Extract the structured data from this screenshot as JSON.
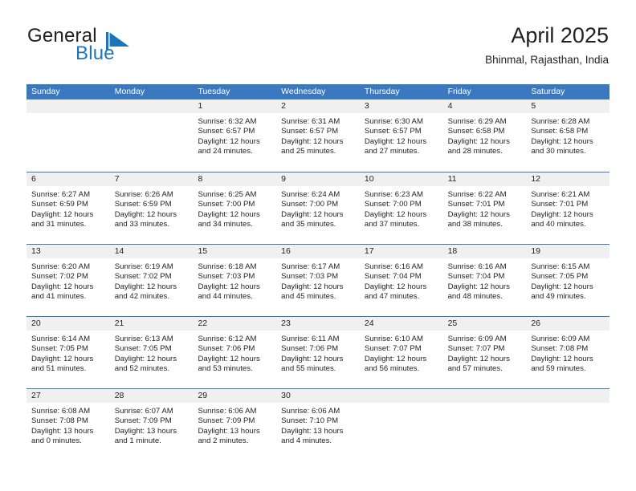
{
  "brand": {
    "word_one": "General",
    "word_two": "Blue",
    "mark": "triangle-flag-icon",
    "accent_color": "#1b75bb"
  },
  "header": {
    "title": "April 2025",
    "subtitle": "Bhinmal, Rajasthan, India"
  },
  "calendar": {
    "header_bg": "#3a78bf",
    "daynum_bg": "#f0f0f0",
    "weekday_headers": [
      "Sunday",
      "Monday",
      "Tuesday",
      "Wednesday",
      "Thursday",
      "Friday",
      "Saturday"
    ],
    "weeks": [
      [
        {
          "day": "",
          "lines": []
        },
        {
          "day": "",
          "lines": []
        },
        {
          "day": "1",
          "lines": [
            "Sunrise: 6:32 AM",
            "Sunset: 6:57 PM",
            "Daylight: 12 hours",
            "and 24 minutes."
          ]
        },
        {
          "day": "2",
          "lines": [
            "Sunrise: 6:31 AM",
            "Sunset: 6:57 PM",
            "Daylight: 12 hours",
            "and 25 minutes."
          ]
        },
        {
          "day": "3",
          "lines": [
            "Sunrise: 6:30 AM",
            "Sunset: 6:57 PM",
            "Daylight: 12 hours",
            "and 27 minutes."
          ]
        },
        {
          "day": "4",
          "lines": [
            "Sunrise: 6:29 AM",
            "Sunset: 6:58 PM",
            "Daylight: 12 hours",
            "and 28 minutes."
          ]
        },
        {
          "day": "5",
          "lines": [
            "Sunrise: 6:28 AM",
            "Sunset: 6:58 PM",
            "Daylight: 12 hours",
            "and 30 minutes."
          ]
        }
      ],
      [
        {
          "day": "6",
          "lines": [
            "Sunrise: 6:27 AM",
            "Sunset: 6:59 PM",
            "Daylight: 12 hours",
            "and 31 minutes."
          ]
        },
        {
          "day": "7",
          "lines": [
            "Sunrise: 6:26 AM",
            "Sunset: 6:59 PM",
            "Daylight: 12 hours",
            "and 33 minutes."
          ]
        },
        {
          "day": "8",
          "lines": [
            "Sunrise: 6:25 AM",
            "Sunset: 7:00 PM",
            "Daylight: 12 hours",
            "and 34 minutes."
          ]
        },
        {
          "day": "9",
          "lines": [
            "Sunrise: 6:24 AM",
            "Sunset: 7:00 PM",
            "Daylight: 12 hours",
            "and 35 minutes."
          ]
        },
        {
          "day": "10",
          "lines": [
            "Sunrise: 6:23 AM",
            "Sunset: 7:00 PM",
            "Daylight: 12 hours",
            "and 37 minutes."
          ]
        },
        {
          "day": "11",
          "lines": [
            "Sunrise: 6:22 AM",
            "Sunset: 7:01 PM",
            "Daylight: 12 hours",
            "and 38 minutes."
          ]
        },
        {
          "day": "12",
          "lines": [
            "Sunrise: 6:21 AM",
            "Sunset: 7:01 PM",
            "Daylight: 12 hours",
            "and 40 minutes."
          ]
        }
      ],
      [
        {
          "day": "13",
          "lines": [
            "Sunrise: 6:20 AM",
            "Sunset: 7:02 PM",
            "Daylight: 12 hours",
            "and 41 minutes."
          ]
        },
        {
          "day": "14",
          "lines": [
            "Sunrise: 6:19 AM",
            "Sunset: 7:02 PM",
            "Daylight: 12 hours",
            "and 42 minutes."
          ]
        },
        {
          "day": "15",
          "lines": [
            "Sunrise: 6:18 AM",
            "Sunset: 7:03 PM",
            "Daylight: 12 hours",
            "and 44 minutes."
          ]
        },
        {
          "day": "16",
          "lines": [
            "Sunrise: 6:17 AM",
            "Sunset: 7:03 PM",
            "Daylight: 12 hours",
            "and 45 minutes."
          ]
        },
        {
          "day": "17",
          "lines": [
            "Sunrise: 6:16 AM",
            "Sunset: 7:04 PM",
            "Daylight: 12 hours",
            "and 47 minutes."
          ]
        },
        {
          "day": "18",
          "lines": [
            "Sunrise: 6:16 AM",
            "Sunset: 7:04 PM",
            "Daylight: 12 hours",
            "and 48 minutes."
          ]
        },
        {
          "day": "19",
          "lines": [
            "Sunrise: 6:15 AM",
            "Sunset: 7:05 PM",
            "Daylight: 12 hours",
            "and 49 minutes."
          ]
        }
      ],
      [
        {
          "day": "20",
          "lines": [
            "Sunrise: 6:14 AM",
            "Sunset: 7:05 PM",
            "Daylight: 12 hours",
            "and 51 minutes."
          ]
        },
        {
          "day": "21",
          "lines": [
            "Sunrise: 6:13 AM",
            "Sunset: 7:05 PM",
            "Daylight: 12 hours",
            "and 52 minutes."
          ]
        },
        {
          "day": "22",
          "lines": [
            "Sunrise: 6:12 AM",
            "Sunset: 7:06 PM",
            "Daylight: 12 hours",
            "and 53 minutes."
          ]
        },
        {
          "day": "23",
          "lines": [
            "Sunrise: 6:11 AM",
            "Sunset: 7:06 PM",
            "Daylight: 12 hours",
            "and 55 minutes."
          ]
        },
        {
          "day": "24",
          "lines": [
            "Sunrise: 6:10 AM",
            "Sunset: 7:07 PM",
            "Daylight: 12 hours",
            "and 56 minutes."
          ]
        },
        {
          "day": "25",
          "lines": [
            "Sunrise: 6:09 AM",
            "Sunset: 7:07 PM",
            "Daylight: 12 hours",
            "and 57 minutes."
          ]
        },
        {
          "day": "26",
          "lines": [
            "Sunrise: 6:09 AM",
            "Sunset: 7:08 PM",
            "Daylight: 12 hours",
            "and 59 minutes."
          ]
        }
      ],
      [
        {
          "day": "27",
          "lines": [
            "Sunrise: 6:08 AM",
            "Sunset: 7:08 PM",
            "Daylight: 13 hours",
            "and 0 minutes."
          ]
        },
        {
          "day": "28",
          "lines": [
            "Sunrise: 6:07 AM",
            "Sunset: 7:09 PM",
            "Daylight: 13 hours",
            "and 1 minute."
          ]
        },
        {
          "day": "29",
          "lines": [
            "Sunrise: 6:06 AM",
            "Sunset: 7:09 PM",
            "Daylight: 13 hours",
            "and 2 minutes."
          ]
        },
        {
          "day": "30",
          "lines": [
            "Sunrise: 6:06 AM",
            "Sunset: 7:10 PM",
            "Daylight: 13 hours",
            "and 4 minutes."
          ]
        },
        {
          "day": "",
          "lines": []
        },
        {
          "day": "",
          "lines": []
        },
        {
          "day": "",
          "lines": []
        }
      ]
    ]
  }
}
